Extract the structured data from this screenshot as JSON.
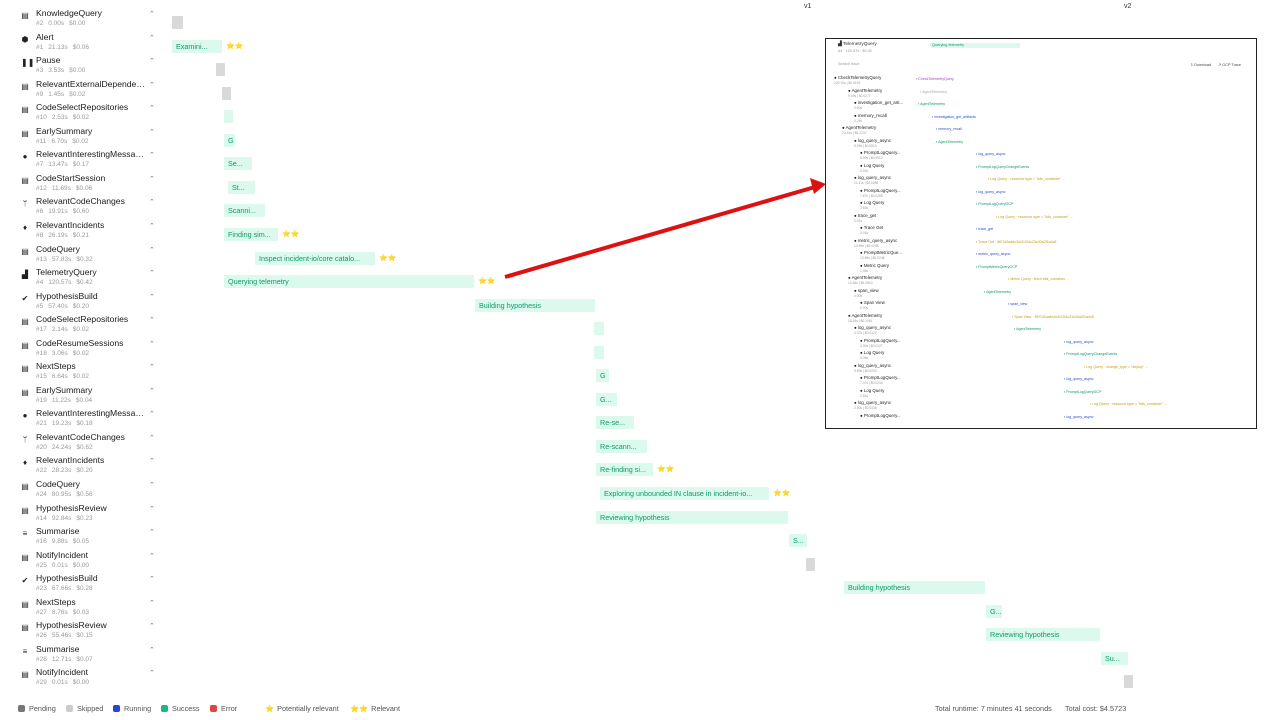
{
  "sidebar": {
    "items": [
      {
        "name": "KnowledgeQuery",
        "num": "#2",
        "time": "0.00s",
        "cost": "$0.00",
        "icon": "doc-icon",
        "glyph": "▤"
      },
      {
        "name": "Alert",
        "num": "#1",
        "time": "21.13s",
        "cost": "$0.06",
        "icon": "shield-icon",
        "glyph": "⬢"
      },
      {
        "name": "Pause",
        "num": "#3",
        "time": "3.53s",
        "cost": "$0.00",
        "icon": "pause-icon",
        "glyph": "❚❚"
      },
      {
        "name": "RelevantExternalDependencies",
        "num": "#9",
        "time": "1.45s",
        "cost": "$0.02",
        "icon": "doc-icon",
        "glyph": "▤"
      },
      {
        "name": "CodeSelectRepositories",
        "num": "#10",
        "time": "2.53s",
        "cost": "$0.02",
        "icon": "doc-icon",
        "glyph": "▤"
      },
      {
        "name": "EarlySummary",
        "num": "#11",
        "time": "6.70s",
        "cost": "$0.02",
        "icon": "doc-icon",
        "glyph": "▤"
      },
      {
        "name": "RelevantInterestingMessages",
        "num": "#7",
        "time": "13.47s",
        "cost": "$0.17",
        "icon": "chat-icon",
        "glyph": "●"
      },
      {
        "name": "CodeStartSession",
        "num": "#12",
        "time": "11.69s",
        "cost": "$0.06",
        "icon": "doc-icon",
        "glyph": "▤"
      },
      {
        "name": "RelevantCodeChanges",
        "num": "#6",
        "time": "19.91s",
        "cost": "$0.60",
        "icon": "branch-icon",
        "glyph": "ᛘ"
      },
      {
        "name": "RelevantIncidents",
        "num": "#8",
        "time": "26.19s",
        "cost": "$0.21",
        "icon": "flame-icon",
        "glyph": "♦"
      },
      {
        "name": "CodeQuery",
        "num": "#13",
        "time": "57.83s",
        "cost": "$0.32",
        "icon": "doc-icon",
        "glyph": "▤"
      },
      {
        "name": "TelemetryQuery",
        "num": "#4",
        "time": "120.57s",
        "cost": "$0.42",
        "icon": "chart-icon",
        "glyph": "▟"
      },
      {
        "name": "HypothesisBuild",
        "num": "#5",
        "time": "57.40s",
        "cost": "$0.20",
        "icon": "check-badge-icon",
        "glyph": "✔"
      },
      {
        "name": "CodeSelectRepositories",
        "num": "#17",
        "time": "2.14s",
        "cost": "$0.02",
        "icon": "doc-icon",
        "glyph": "▤"
      },
      {
        "name": "CodeResumeSessions",
        "num": "#18",
        "time": "3.06s",
        "cost": "$0.02",
        "icon": "doc-icon",
        "glyph": "▤"
      },
      {
        "name": "NextSteps",
        "num": "#15",
        "time": "6.64s",
        "cost": "$0.02",
        "icon": "doc-icon",
        "glyph": "▤"
      },
      {
        "name": "EarlySummary",
        "num": "#19",
        "time": "11.22s",
        "cost": "$0.04",
        "icon": "doc-icon",
        "glyph": "▤"
      },
      {
        "name": "RelevantInterestingMessages",
        "num": "#21",
        "time": "19.23s",
        "cost": "$0.18",
        "icon": "chat-icon",
        "glyph": "●"
      },
      {
        "name": "RelevantCodeChanges",
        "num": "#20",
        "time": "24.24s",
        "cost": "$0.62",
        "icon": "branch-icon",
        "glyph": "ᛘ"
      },
      {
        "name": "RelevantIncidents",
        "num": "#22",
        "time": "28.23s",
        "cost": "$0.20",
        "icon": "flame-icon",
        "glyph": "♦"
      },
      {
        "name": "CodeQuery",
        "num": "#24",
        "time": "80.95s",
        "cost": "$0.56",
        "icon": "doc-icon",
        "glyph": "▤"
      },
      {
        "name": "HypothesisReview",
        "num": "#14",
        "time": "92.84s",
        "cost": "$0.23",
        "icon": "doc-icon",
        "glyph": "▤"
      },
      {
        "name": "Summarise",
        "num": "#16",
        "time": "9.88s",
        "cost": "$0.05",
        "icon": "list-icon",
        "glyph": "≡"
      },
      {
        "name": "NotifyIncident",
        "num": "#25",
        "time": "0.01s",
        "cost": "$0.00",
        "icon": "doc-icon",
        "glyph": "▤"
      },
      {
        "name": "HypothesisBuild",
        "num": "#23",
        "time": "67.66s",
        "cost": "$0.28",
        "icon": "check-badge-icon",
        "glyph": "✔"
      },
      {
        "name": "NextSteps",
        "num": "#27",
        "time": "8.76s",
        "cost": "$0.03",
        "icon": "doc-icon",
        "glyph": "▤"
      },
      {
        "name": "HypothesisReview",
        "num": "#26",
        "time": "55.46s",
        "cost": "$0.15",
        "icon": "doc-icon",
        "glyph": "▤"
      },
      {
        "name": "Summarise",
        "num": "#28",
        "time": "12.71s",
        "cost": "$0.07",
        "icon": "list-icon",
        "glyph": "≡"
      },
      {
        "name": "NotifyIncident",
        "num": "#29",
        "time": "0.01s",
        "cost": "$0.00",
        "icon": "doc-icon",
        "glyph": "▤"
      }
    ]
  },
  "timeline": {
    "v1_label": "v1",
    "v2_label": "v2",
    "bars": [
      {
        "label": "",
        "status": "pending",
        "stars": ""
      },
      {
        "label": "Examini...",
        "status": "success",
        "stars": "⭐⭐"
      },
      {
        "label": "",
        "status": "pending",
        "stars": ""
      },
      {
        "label": "",
        "status": "skipped",
        "stars": ""
      },
      {
        "label": "",
        "status": "success",
        "stars": ""
      },
      {
        "label": "G",
        "status": "success",
        "stars": ""
      },
      {
        "label": "Se...",
        "status": "success",
        "stars": ""
      },
      {
        "label": "St...",
        "status": "success",
        "stars": ""
      },
      {
        "label": "Scanni...",
        "status": "success",
        "stars": ""
      },
      {
        "label": "Finding sim...",
        "status": "success",
        "stars": "⭐⭐"
      },
      {
        "label": "Inspect incident-io/core catalo...",
        "status": "success",
        "stars": "⭐⭐"
      },
      {
        "label": "Querying telemetry",
        "status": "success",
        "stars": "⭐⭐"
      },
      {
        "label": "Building hypothesis",
        "status": "success",
        "stars": ""
      },
      {
        "label": "",
        "status": "success",
        "stars": ""
      },
      {
        "label": "",
        "status": "success",
        "stars": ""
      },
      {
        "label": "G",
        "status": "success",
        "stars": ""
      },
      {
        "label": "G...",
        "status": "success",
        "stars": ""
      },
      {
        "label": "Re-se...",
        "status": "success",
        "stars": ""
      },
      {
        "label": "Re-scann...",
        "status": "success",
        "stars": ""
      },
      {
        "label": "Re-finding si...",
        "status": "success",
        "stars": "⭐⭐"
      },
      {
        "label": "Exploring unbounded IN clause in incident-io...",
        "status": "success",
        "stars": "⭐⭐"
      },
      {
        "label": "Reviewing hypothesis",
        "status": "success",
        "stars": ""
      },
      {
        "label": "S...",
        "status": "success",
        "stars": ""
      },
      {
        "label": "",
        "status": "pending",
        "stars": ""
      },
      {
        "label": "Building hypothesis",
        "status": "success",
        "stars": ""
      },
      {
        "label": "G...",
        "status": "success",
        "stars": ""
      },
      {
        "label": "Reviewing hypothesis",
        "status": "success",
        "stars": ""
      },
      {
        "label": "Su...",
        "status": "success",
        "stars": ""
      },
      {
        "label": "",
        "status": "pending",
        "stars": ""
      }
    ]
  },
  "zoom": {
    "title": "TelemetryQuery",
    "subtitle": "#4 · 120.57s · $0.42",
    "tab": "Querying telemetry",
    "search_placeholder": "Search trace",
    "download": "Download",
    "gcp_trace": "GCP Trace",
    "left_rows": [
      {
        "label": "CheckTelemetryQuery",
        "meta": "120.10s | $0.4193"
      },
      {
        "label": "AgentTelemetry",
        "meta": "9.09s | $0.0277"
      },
      {
        "label": "investigation_get_arti...",
        "meta": "0.00s"
      },
      {
        "label": "memory_recall",
        "meta": "0.24s"
      },
      {
        "label": "AgentTelemetry",
        "meta": "23.44s | $0.1237"
      },
      {
        "label": "log_query_async",
        "meta": "5.93s | $0.0510"
      },
      {
        "label": "PromptLogQuery...",
        "meta": "5.90s | $0.0510"
      },
      {
        "label": "Log Query",
        "meta": "0.02s"
      },
      {
        "label": "log_query_async",
        "meta": "11.31s | $0.0285"
      },
      {
        "label": "PromptLogQuery...",
        "meta": "7.67s | $0.0285"
      },
      {
        "label": "Log Query",
        "meta": "3.63s"
      },
      {
        "label": "trace_get",
        "meta": "0.01s"
      },
      {
        "label": "Trace Get",
        "meta": "0.01s"
      },
      {
        "label": "metric_query_async",
        "meta": "13.69s | $0.0248"
      },
      {
        "label": "PromptMetricQue...",
        "meta": "13.69s | $0.0248"
      },
      {
        "label": "Metric Query",
        "meta": "1.04s"
      },
      {
        "label": "AgentTelemetry",
        "meta": "10.48s | $0.0510"
      },
      {
        "label": "span_view",
        "meta": "0.00s"
      },
      {
        "label": "Span View",
        "meta": "0.00s"
      },
      {
        "label": "AgentTelemetry",
        "meta": "18.19s | $0.1061"
      },
      {
        "label": "log_query_async",
        "meta": "4.37s | $0.0127"
      },
      {
        "label": "PromptLogQuery...",
        "meta": "4.30s | $0.0127"
      },
      {
        "label": "Log Query",
        "meta": "0.06s"
      },
      {
        "label": "log_query_async",
        "meta": "9.89s | $0.0234"
      },
      {
        "label": "PromptLogQuery...",
        "meta": "7.37s | $0.0234"
      },
      {
        "label": "Log Query",
        "meta": "2.51s"
      },
      {
        "label": "log_query_async",
        "meta": "2.90s | $0.0108"
      },
      {
        "label": "PromptLogQuery...",
        "meta": ""
      }
    ],
    "right_rows": [
      {
        "label": "CheckTelemetryQuery",
        "color": "p"
      },
      {
        "label": "AgentTelemetry",
        "color": "gr"
      },
      {
        "label": "AgentTelemetry",
        "color": "g"
      },
      {
        "label": "investigation_get_artifacts",
        "color": "b"
      },
      {
        "label": "memory_recall",
        "color": "b"
      },
      {
        "label": "AgentTelemetry",
        "color": "g"
      },
      {
        "label": "log_query_async",
        "color": "b"
      },
      {
        "label": "PromptLogQueryChangeEvents",
        "color": "g"
      },
      {
        "label": "Log Query · resource.type = \"k8s_container\" ...",
        "color": "y"
      },
      {
        "label": "log_query_async",
        "color": "b"
      },
      {
        "label": "PromptLogQueryGCP",
        "color": "g"
      },
      {
        "label": "Log Query · resource.type = \"k8s_container\" ...",
        "color": "y"
      },
      {
        "label": "trace_get",
        "color": "b"
      },
      {
        "label": "Trace Get · 8f07d2aa6c3d1f12f4c23c00a2f1a4c8",
        "color": "y"
      },
      {
        "label": "metric_query_async",
        "color": "b"
      },
      {
        "label": "PromptMetricQueryGCP",
        "color": "g"
      },
      {
        "label": "Metric Query · fetch k8s_container ...",
        "color": "y"
      },
      {
        "label": "AgentTelemetry",
        "color": "g"
      },
      {
        "label": "span_view",
        "color": "b"
      },
      {
        "label": "Span View · 8f07d2aa6c3d1f12f4c23c00a2f1a4c8",
        "color": "y"
      },
      {
        "label": "AgentTelemetry",
        "color": "g"
      },
      {
        "label": "log_query_async",
        "color": "b"
      },
      {
        "label": "PromptLogQueryChangeEvents",
        "color": "g"
      },
      {
        "label": "Log Query · change_type = \"deploy\" ...",
        "color": "y"
      },
      {
        "label": "log_query_async",
        "color": "b"
      },
      {
        "label": "PromptLogQueryGCP",
        "color": "g"
      },
      {
        "label": "Log Query · resource.type = \"k8s_container\" ...",
        "color": "y"
      },
      {
        "label": "log_query_async",
        "color": "b"
      }
    ]
  },
  "legend": {
    "pending": "Pending",
    "skipped": "Skipped",
    "running": "Running",
    "success": "Success",
    "error": "Error",
    "potentially_relevant": "Potentially relevant",
    "relevant": "Relevant",
    "one_star": "⭐",
    "two_star": "⭐⭐"
  },
  "totals": {
    "runtime": "Total runtime: 7 minutes 41 seconds",
    "cost": "Total cost: $4.5723"
  },
  "colors": {
    "pending": "#777777",
    "skipped": "#cccccc",
    "running": "#2447d6",
    "success": "#16b886",
    "error": "#e04545",
    "arrow": "#dd1111"
  }
}
